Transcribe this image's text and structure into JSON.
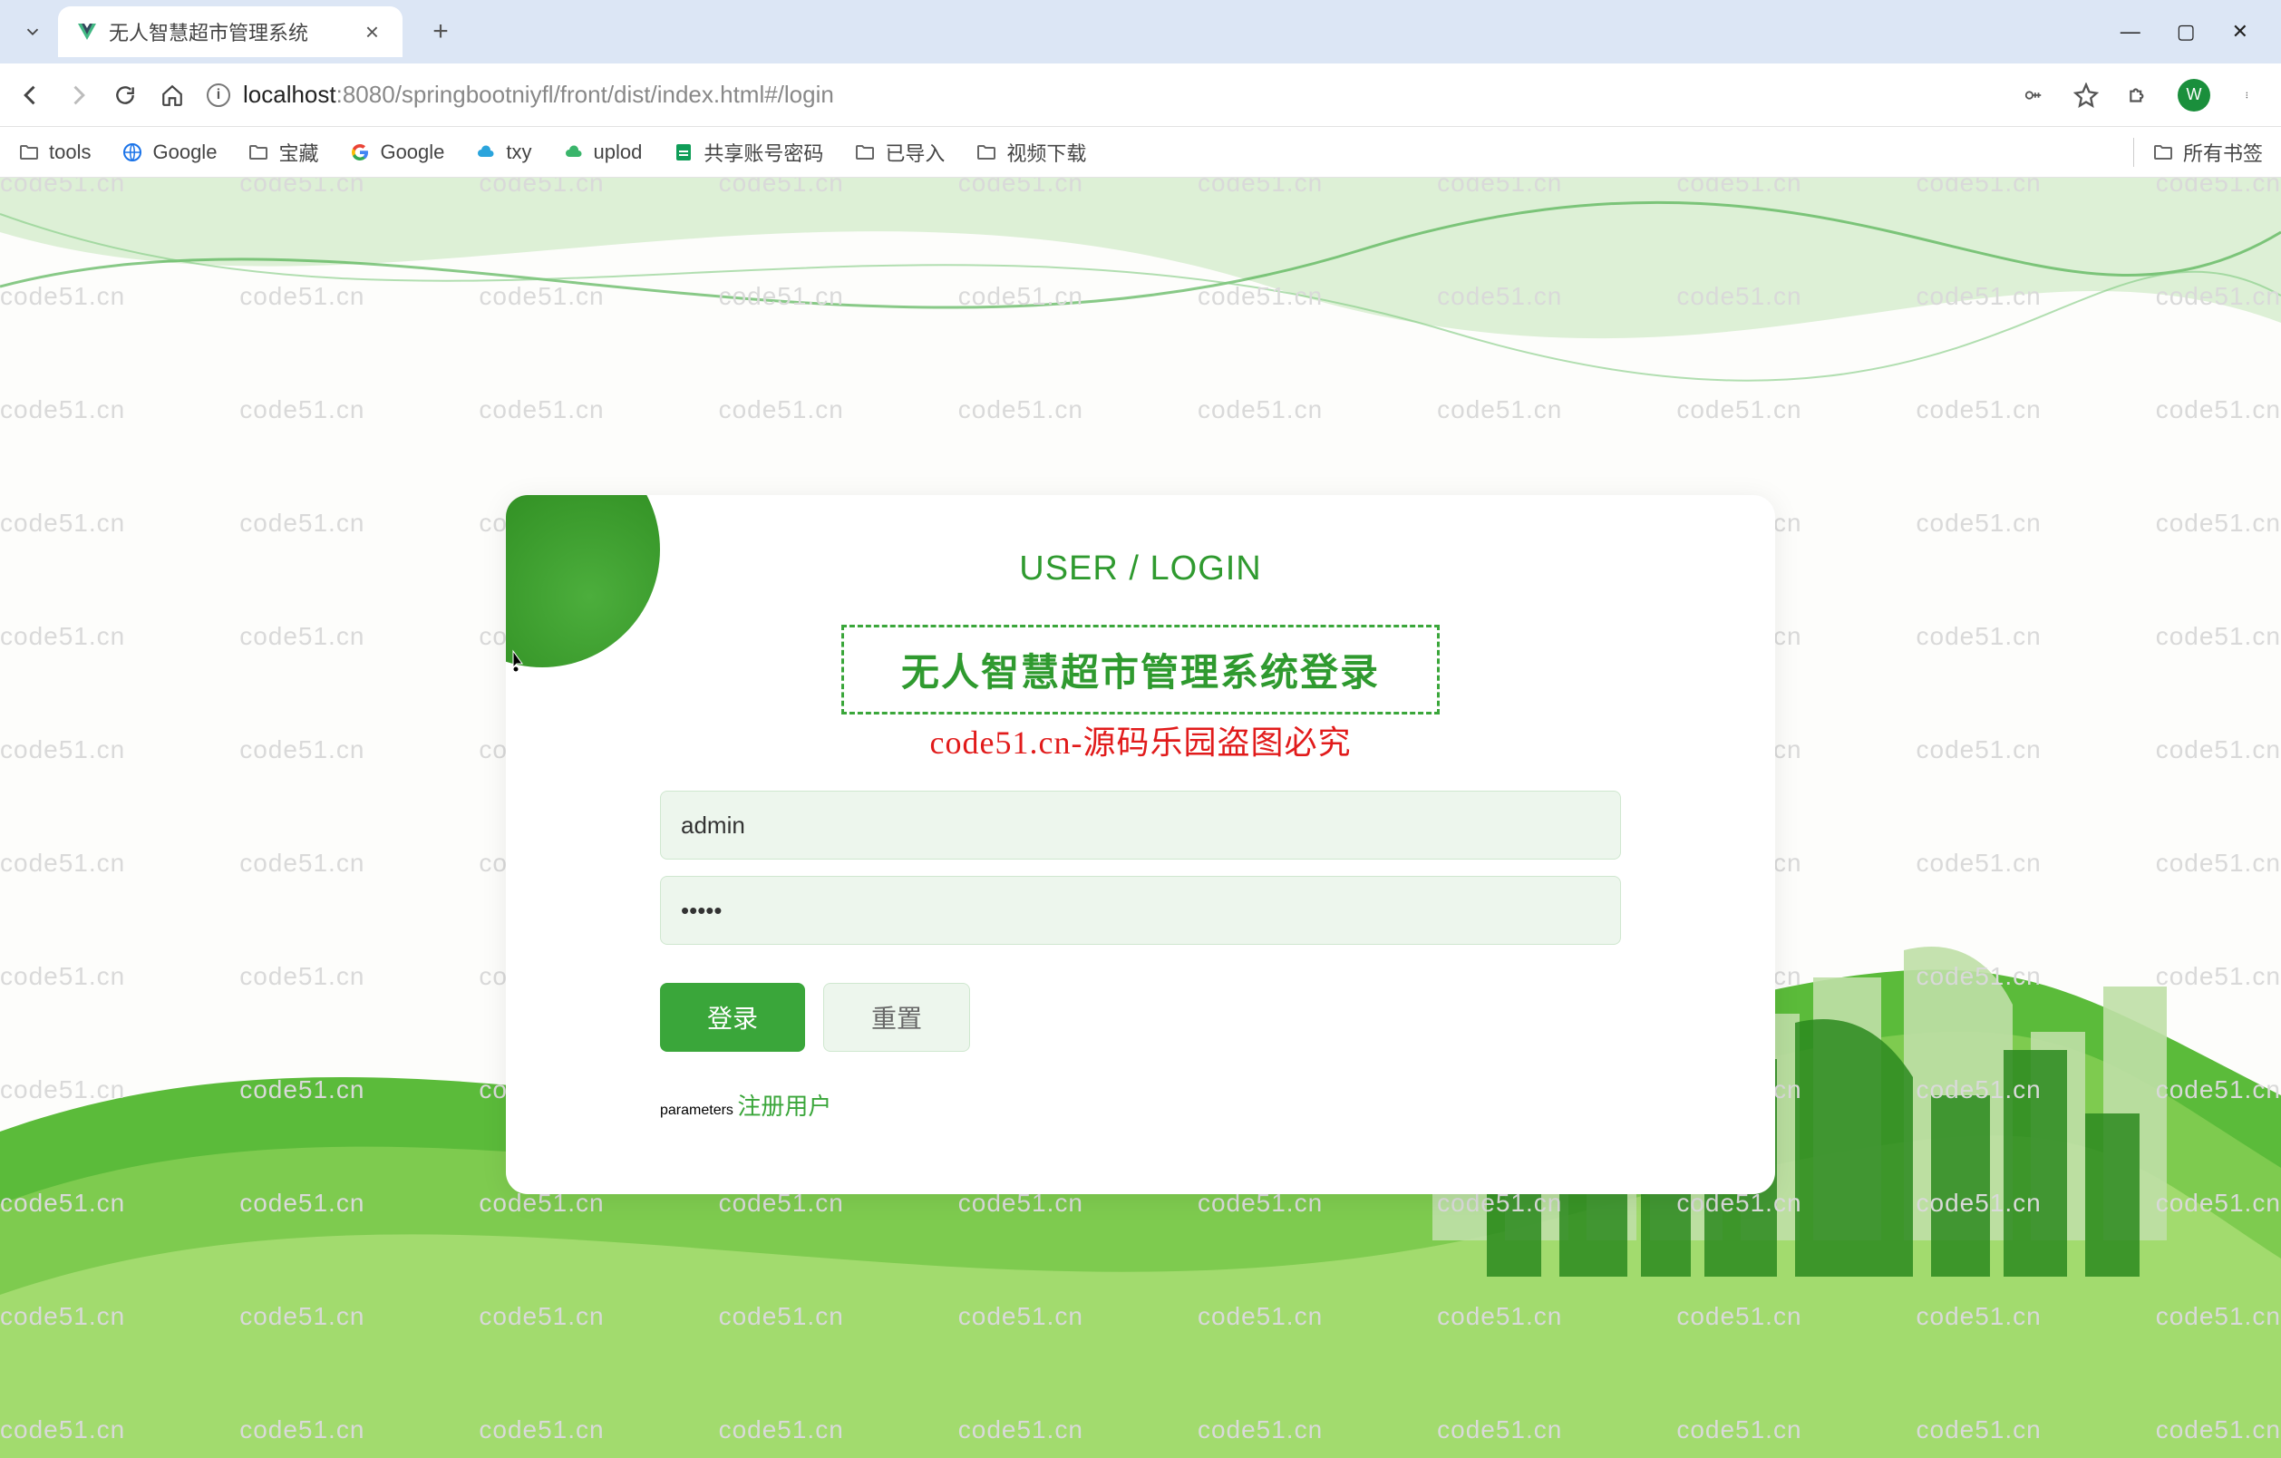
{
  "browser": {
    "tab_title": "无人智慧超市管理系统",
    "url_host": "localhost",
    "url_path": ":8080/springbootniyfl/front/dist/index.html#/login",
    "avatar_letter": "W"
  },
  "bookmarks": {
    "items": [
      {
        "label": "tools",
        "icon": "folder"
      },
      {
        "label": "Google",
        "icon": "google-world"
      },
      {
        "label": "宝藏",
        "icon": "folder"
      },
      {
        "label": "Google",
        "icon": "google-g"
      },
      {
        "label": "txy",
        "icon": "cloud"
      },
      {
        "label": "uplod",
        "icon": "cloud-alt"
      },
      {
        "label": "共享账号密码",
        "icon": "sheet"
      },
      {
        "label": "已导入",
        "icon": "folder"
      },
      {
        "label": "视频下载",
        "icon": "folder"
      }
    ],
    "all_label": "所有书签"
  },
  "watermark_text": "code51.cn",
  "login": {
    "heading": "USER / LOGIN",
    "title": "无人智慧超市管理系统登录",
    "warning": "code51.cn-源码乐园盗图必究",
    "username_value": "admin",
    "password_value": "•••••",
    "login_btn": "登录",
    "reset_btn": "重置",
    "register_link": "注册用户"
  }
}
